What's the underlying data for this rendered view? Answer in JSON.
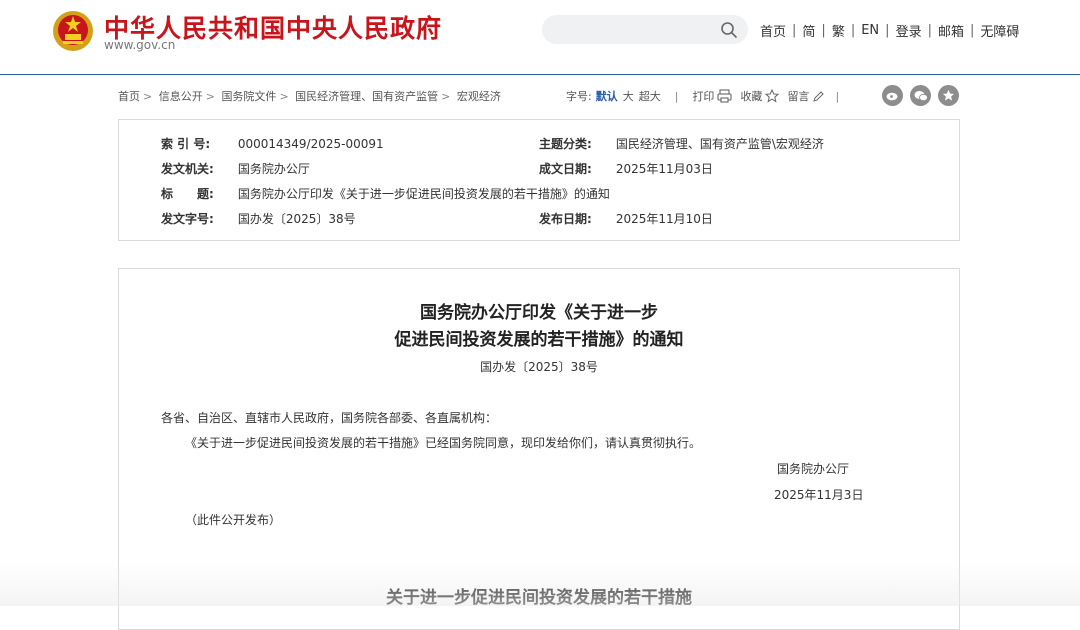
{
  "header": {
    "site_title": "中华人民共和国中央人民政府",
    "site_url": "www.gov.cn",
    "search_placeholder": "",
    "nav": [
      "首页",
      "简",
      "繁",
      "EN",
      "登录",
      "邮箱",
      "无障碍"
    ]
  },
  "breadcrumb": [
    "首页",
    "信息公开",
    "国务院文件",
    "国民经济管理、国有资产监管",
    "宏观经济"
  ],
  "tools": {
    "font_label": "字号:",
    "font_default": "默认",
    "font_large": "大",
    "font_xlarge": "超大",
    "print": "打印",
    "favorite": "收藏",
    "comment": "留言"
  },
  "social_icons": [
    "weibo-icon",
    "wechat-icon",
    "star-icon"
  ],
  "meta": {
    "index_label": "索 引 号:",
    "index_value": "000014349/2025-00091",
    "category_label": "主题分类:",
    "category_value": "国民经济管理、国有资产监管\\宏观经济",
    "issuer_label": "发文机关:",
    "issuer_value": "国务院办公厅",
    "written_label": "成文日期:",
    "written_value": "2025年11月03日",
    "title_label": "标　　题:",
    "title_value": "国务院办公厅印发《关于进一步促进民间投资发展的若干措施》的通知",
    "docno_label": "发文字号:",
    "docno_value": "国办发〔2025〕38号",
    "published_label": "发布日期:",
    "published_value": "2025年11月10日"
  },
  "article": {
    "title_line1": "国务院办公厅印发《关于进一步",
    "title_line2": "促进民间投资发展的若干措施》的通知",
    "doc_number": "国办发〔2025〕38号",
    "salutation": "各省、自治区、直辖市人民政府，国务院各部委、各直属机构：",
    "body": "《关于进一步促进民间投资发展的若干措施》已经国务院同意，现印发给你们，请认真贯彻执行。",
    "signer": "国务院办公厅",
    "date": "2025年11月3日",
    "public_note": "（此件公开发布）",
    "subtitle": "关于进一步促进民间投资发展的若干措施"
  },
  "colors": {
    "brand_red": "#c8141b",
    "accent_blue": "#2a5caa"
  }
}
